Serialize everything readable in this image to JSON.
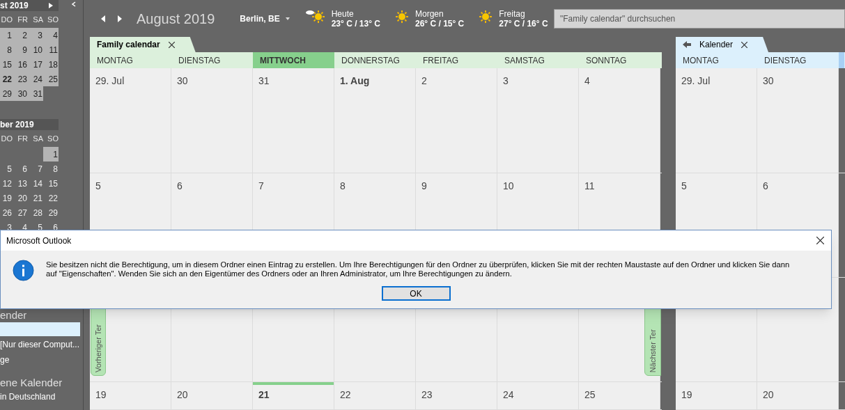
{
  "sidebar": {
    "months": [
      {
        "title": "st 2019",
        "headers": [
          "DO",
          "FR",
          "SA",
          "SO"
        ],
        "rows": [
          [
            {
              "text": "1",
              "shaded": true,
              "today": false
            },
            {
              "text": "2",
              "shaded": true,
              "today": false
            },
            {
              "text": "3",
              "shaded": true,
              "today": false
            },
            {
              "text": "4",
              "shaded": true,
              "today": false
            }
          ],
          [
            {
              "text": "8",
              "shaded": true,
              "today": false
            },
            {
              "text": "9",
              "shaded": true,
              "today": false
            },
            {
              "text": "10",
              "shaded": true,
              "today": false
            },
            {
              "text": "11",
              "shaded": true,
              "today": false
            }
          ],
          [
            {
              "text": "15",
              "shaded": true,
              "today": false
            },
            {
              "text": "16",
              "shaded": true,
              "today": false
            },
            {
              "text": "17",
              "shaded": true,
              "today": false
            },
            {
              "text": "18",
              "shaded": true,
              "today": false
            }
          ],
          [
            {
              "text": "22",
              "shaded": true,
              "today": true
            },
            {
              "text": "23",
              "shaded": true,
              "today": false
            },
            {
              "text": "24",
              "shaded": true,
              "today": false
            },
            {
              "text": "25",
              "shaded": true,
              "today": false
            }
          ],
          [
            {
              "text": "29",
              "shaded": true,
              "today": false
            },
            {
              "text": "30",
              "shaded": true,
              "today": false
            },
            {
              "text": "31",
              "shaded": true,
              "today": false
            },
            {
              "shaded": false
            }
          ]
        ]
      },
      {
        "title": "ber 2019",
        "headers": [
          "DO",
          "FR",
          "SA",
          "SO"
        ],
        "rows": [
          [
            {
              "shaded": false
            },
            {
              "shaded": false
            },
            {
              "shaded": false
            },
            {
              "text": "1",
              "shaded": true,
              "today": false
            }
          ],
          [
            {
              "text": "5",
              "shaded": false,
              "today": false
            },
            {
              "text": "6",
              "shaded": false,
              "today": false
            },
            {
              "text": "7",
              "shaded": false,
              "today": false
            },
            {
              "text": "8",
              "shaded": false,
              "today": false
            }
          ],
          [
            {
              "text": "12",
              "shaded": false,
              "today": false
            },
            {
              "text": "13",
              "shaded": false,
              "today": false
            },
            {
              "text": "14",
              "shaded": false,
              "today": false
            },
            {
              "text": "15",
              "shaded": false,
              "today": false
            }
          ],
          [
            {
              "text": "19",
              "shaded": false,
              "today": false
            },
            {
              "text": "20",
              "shaded": false,
              "today": false
            },
            {
              "text": "21",
              "shaded": false,
              "today": false
            },
            {
              "text": "22",
              "shaded": false,
              "today": false
            }
          ],
          [
            {
              "text": "26",
              "shaded": false,
              "today": false
            },
            {
              "text": "27",
              "shaded": false,
              "today": false
            },
            {
              "text": "28",
              "shaded": false,
              "today": false
            },
            {
              "text": "29",
              "shaded": false,
              "today": false
            }
          ],
          [
            {
              "text": "3",
              "shaded": false,
              "today": false
            },
            {
              "text": "4",
              "shaded": false,
              "today": false
            },
            {
              "text": "5",
              "shaded": false,
              "today": false
            },
            {
              "text": "6",
              "shaded": false,
              "today": false
            }
          ]
        ]
      }
    ],
    "sections": [
      {
        "heading": "ender",
        "items": [
          {
            "selected": true
          },
          {
            "label": "[Nur dieser Comput...",
            "selected": false
          },
          {
            "label": "ge",
            "selected": false
          }
        ]
      },
      {
        "heading": "ene Kalender",
        "items": [
          {
            "label": "in Deutschland",
            "selected": false
          }
        ]
      }
    ]
  },
  "toolbar": {
    "month": "August 2019",
    "location": "Berlin, BE",
    "weather": [
      {
        "day": "Heute",
        "temps": "23° C / 13° C",
        "kind": "sun-cloud"
      },
      {
        "day": "Morgen",
        "temps": "26° C / 15° C",
        "kind": "sun"
      },
      {
        "day": "Freitag",
        "temps": "27° C / 16° C",
        "kind": "sun"
      }
    ],
    "search": {
      "placeholder": "\"Family calendar\" durchsuchen"
    }
  },
  "calendars": [
    {
      "tab": "Family calendar",
      "kind": "green",
      "back_arrow": false,
      "columns": [
        {
          "label": "MONTAG",
          "selected": false
        },
        {
          "label": "DIENSTAG",
          "selected": false
        },
        {
          "label": "MITTWOCH",
          "selected": true
        },
        {
          "label": "DONNERSTAG",
          "selected": false
        },
        {
          "label": "FREITAG",
          "selected": false
        },
        {
          "label": "SAMSTAG",
          "selected": false
        },
        {
          "label": "SONNTAG",
          "selected": false
        }
      ],
      "weeks": [
        [
          {
            "label": "29. Jul",
            "bold": false,
            "today": false
          },
          {
            "label": "30",
            "bold": false,
            "today": false
          },
          {
            "label": "31",
            "bold": false,
            "today": false
          },
          {
            "label": "1. Aug",
            "bold": true,
            "today": false
          },
          {
            "label": "2",
            "bold": false,
            "today": false
          },
          {
            "label": "3",
            "bold": false,
            "today": false
          },
          {
            "label": "4",
            "bold": false,
            "today": false
          }
        ],
        [
          {
            "label": "5",
            "bold": false,
            "today": false
          },
          {
            "label": "6",
            "bold": false,
            "today": false
          },
          {
            "label": "7",
            "bold": false,
            "today": false
          },
          {
            "label": "8",
            "bold": false,
            "today": false
          },
          {
            "label": "9",
            "bold": false,
            "today": false
          },
          {
            "label": "10",
            "bold": false,
            "today": false
          },
          {
            "label": "11",
            "bold": false,
            "today": false
          }
        ],
        [
          {
            "label": "19",
            "bold": false,
            "today": false
          },
          {
            "label": "20",
            "bold": false,
            "today": false
          },
          {
            "label": "21",
            "bold": true,
            "today": true
          },
          {
            "label": "22",
            "bold": false,
            "today": false
          },
          {
            "label": "23",
            "bold": false,
            "today": false
          },
          {
            "label": "24",
            "bold": false,
            "today": false
          },
          {
            "label": "25",
            "bold": false,
            "today": false
          }
        ]
      ],
      "prev_tab": "Vorheriger Ter",
      "next_tab": "Nächster Ter"
    },
    {
      "tab": "Kalender",
      "kind": "blue",
      "back_arrow": true,
      "columns": [
        {
          "label": "MONTAG",
          "selected": false
        },
        {
          "label": "DIENSTAG",
          "selected": false
        }
      ],
      "weeks": [
        [
          {
            "label": "29. Jul",
            "bold": false,
            "today": false
          },
          {
            "label": "30",
            "bold": false,
            "today": false
          }
        ],
        [
          {
            "label": "5",
            "bold": false,
            "today": false
          },
          {
            "label": "6",
            "bold": false,
            "today": false
          }
        ],
        [
          {
            "label": "19",
            "bold": false,
            "today": false
          },
          {
            "label": "20",
            "bold": false,
            "today": false
          }
        ]
      ]
    }
  ],
  "dialog": {
    "title": "Microsoft Outlook",
    "message": "Sie besitzen nicht die Berechtigung, um in diesem Ordner einen Eintrag zu erstellen. Um Ihre Berechtigungen für den Ordner zu überprüfen, klicken Sie mit der rechten Maustaste auf den Ordner und klicken Sie dann auf \"Eigenschaften\". Wenden Sie sich an den Eigentümer des Ordners oder an Ihren Administrator, um Ihre Berechtigungen zu ändern.",
    "button": "OK"
  }
}
